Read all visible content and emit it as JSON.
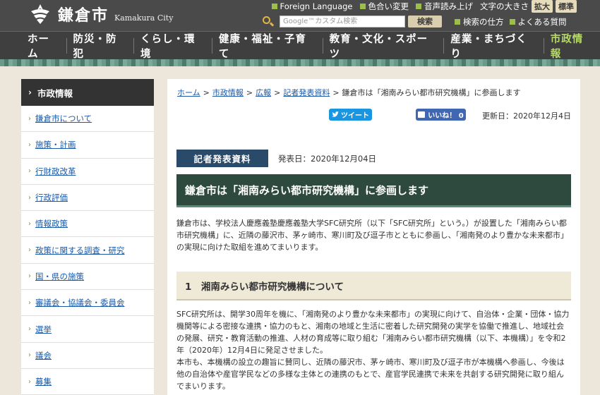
{
  "header": {
    "logo_ja": "鎌倉市",
    "logo_en": "Kamakura City",
    "util": [
      "Foreign Language",
      "色合い変更",
      "音声読み上げ"
    ],
    "text_size_label": "文字の大きさ",
    "size_enlarge": "拡大",
    "size_standard": "標準",
    "search_placeholder": "Google™カスタム検索",
    "search_button": "検索",
    "search_links": [
      "検索の仕方",
      "よくある質問"
    ]
  },
  "nav": [
    "ホーム",
    "防災・防犯",
    "くらし・環境",
    "健康・福祉・子育て",
    "教育・文化・スポーツ",
    "産業・まちづくり",
    "市政情報"
  ],
  "sidebar": {
    "heading": "市政情報",
    "items": [
      "鎌倉市について",
      "施策・計画",
      "行財政改革",
      "行政評価",
      "情報政策",
      "政策に関する調査・研究",
      "国・県の施策",
      "審議会・協議会・委員会",
      "選挙",
      "議会",
      "募集"
    ]
  },
  "breadcrumb": [
    "ホーム",
    "市政情報",
    "広報",
    "記者発表資料"
  ],
  "breadcrumb_current": "鎌倉市は「湘南みらい都市研究機構」に参画します",
  "tweet_label": "ツイート",
  "like_label": "いいね！ 0",
  "updated": "更新日：2020年12月4日",
  "press_badge": "記者発表資料",
  "press_date": "発表日：2020年12月04日",
  "title": "鎌倉市は「湘南みらい都市研究機構」に参画します",
  "paragraph1": "鎌倉市は、学校法人慶應義塾慶應義塾大学SFC研究所（以下「SFC研究所」という。）が設置した「湘南みらい都市研究機構」に、近隣の藤沢市、茅ヶ崎市、寒川町及び逗子市とともに参画し、「湘南発のより豊かな未来都市」の実現に向けた取組を進めてまいります。",
  "section1": "1　湘南みらい都市研究機構について",
  "paragraph2": "SFC研究所は、開学30周年を機に、「湘南発のより豊かな未来都市」の実現に向けて、自治体・企業・団体・協力機関等による密接な連携・協力のもと、湘南の地域と生活に密着した研究開発の実学を協働で推進し、地域社会の発展、研究・教育活動の推進、人材の育成等に取り組む「湘南みらい都市研究機構（以下、本機構）」を令和2年（2020年）12月4日に発足させました。",
  "paragraph3": "本市も、本機構の設立の趣旨に賛同し、近隣の藤沢市、茅ヶ崎市、寒川町及び逗子市が本機構へ参画し、今後は他の自治体や産官学民などの多様な主体との連携のもとで、産官学民連携で未来を共創する研究開発に取り組んでまいります。"
}
